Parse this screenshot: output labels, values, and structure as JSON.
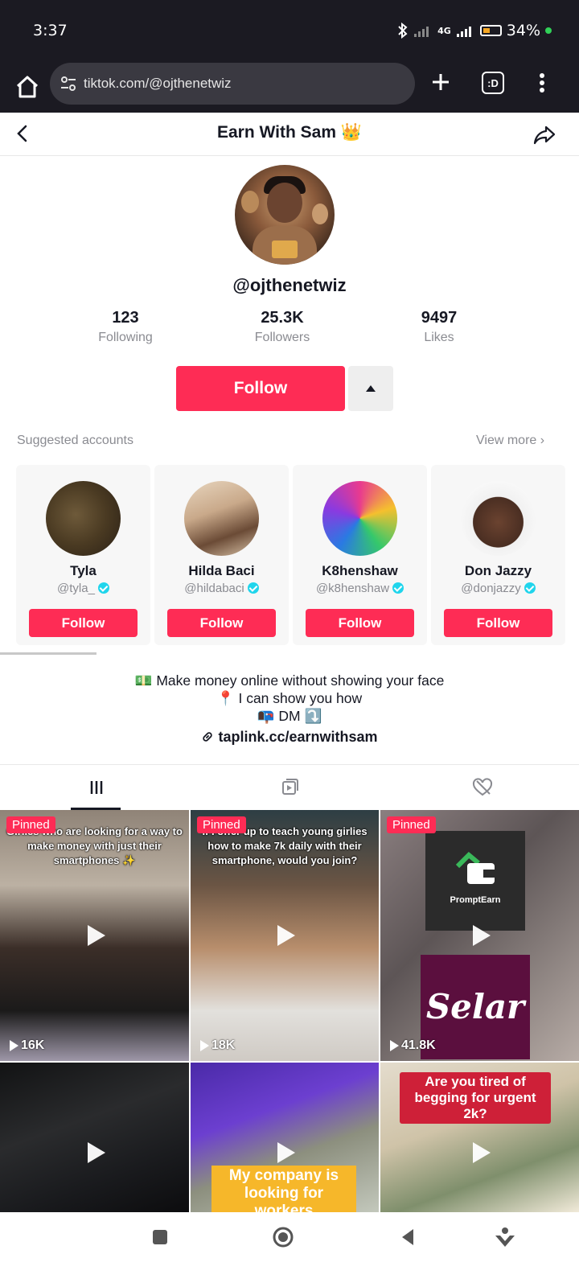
{
  "status_bar": {
    "time": "3:37",
    "network": "4G",
    "battery": "34%"
  },
  "browser": {
    "url": "tiktok.com/@ojthenetwiz",
    "tabs_label": ":D"
  },
  "header": {
    "title": "Earn With Sam 👑"
  },
  "profile": {
    "username": "@ojthenetwiz",
    "stats": [
      {
        "value": "123",
        "label": "Following"
      },
      {
        "value": "25.3K",
        "label": "Followers"
      },
      {
        "value": "9497",
        "label": "Likes"
      }
    ],
    "follow_label": "Follow"
  },
  "suggested": {
    "title": "Suggested accounts",
    "view_more": "View more",
    "accounts": [
      {
        "name": "Tyla",
        "handle": "@tyla_",
        "follow": "Follow"
      },
      {
        "name": "Hilda Baci",
        "handle": "@hildabaci",
        "follow": "Follow"
      },
      {
        "name": "K8henshaw",
        "handle": "@k8henshaw",
        "follow": "Follow"
      },
      {
        "name": "Don Jazzy",
        "handle": "@donjazzy",
        "follow": "Follow"
      }
    ]
  },
  "bio": {
    "line1": "💵 Make money online without showing your face",
    "line2": "📍 I can show you how",
    "line3": "📭 DM ⤵️",
    "link": "taplink.cc/earnwithsam"
  },
  "videos": [
    {
      "pinned": "Pinned",
      "caption": "Girlies who are looking for a way to make money with just their smartphones ✨",
      "views": "16K"
    },
    {
      "pinned": "Pinned",
      "caption": "If I offer up to teach young girlies how to make 7k daily with their smartphone, would you join?",
      "views": "18K"
    },
    {
      "pinned": "Pinned",
      "caption": "",
      "views": "41.8K",
      "logo": "PromptEarn",
      "brand": "Selar"
    },
    {
      "caption": ""
    },
    {
      "caption": "My company is looking for workers"
    },
    {
      "caption": "Are you tired of begging for urgent 2k?"
    }
  ],
  "colors": {
    "accent": "#fe2c55",
    "verified": "#20d5ec"
  }
}
